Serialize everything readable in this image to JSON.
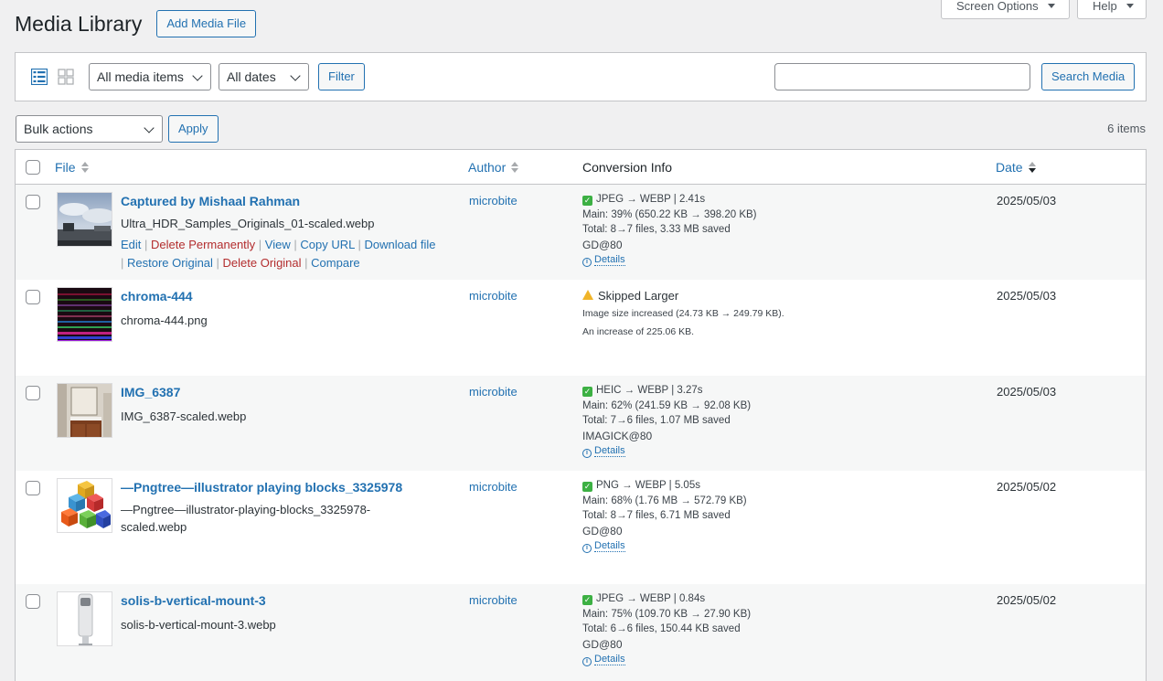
{
  "header": {
    "title": "Media Library",
    "add_new_label": "Add Media File",
    "screen_options_label": "Screen Options",
    "help_label": "Help"
  },
  "filters": {
    "media_type": "All media items",
    "dates": "All dates",
    "filter_label": "Filter",
    "search_placeholder": "",
    "search_button_label": "Search Media"
  },
  "bulk": {
    "action_label": "Bulk actions",
    "apply_label": "Apply",
    "items_count": "6 items"
  },
  "columns": {
    "file": "File",
    "author": "Author",
    "conversion": "Conversion Info",
    "date": "Date"
  },
  "rows": [
    {
      "title": "Captured by Mishaal Rahman",
      "filename": "Ultra_HDR_Samples_Originals_01-scaled.webp",
      "author": "microbite",
      "date": "2025/05/03",
      "actions": {
        "edit": "Edit",
        "delete_permanently": "Delete Permanently",
        "view": "View",
        "copy_url": "Copy URL",
        "download": "Download file",
        "restore": "Restore Original",
        "delete_original": "Delete Original",
        "compare": "Compare"
      },
      "conv": {
        "line1": "JPEG → WEBP | 2.41s",
        "line2": "Main: 39% (650.22 KB → 398.20 KB)",
        "line3": "Total: 8→7 files, 3.33 MB saved",
        "line4": "GD@80",
        "details": "Details"
      }
    },
    {
      "title": "chroma-444",
      "filename": "chroma-444.png",
      "author": "microbite",
      "date": "2025/05/03",
      "conv": {
        "status": "Skipped Larger",
        "line2": "Image size increased (24.73 KB → 249.79 KB).",
        "line3": "An increase of 225.06 KB."
      }
    },
    {
      "title": "IMG_6387",
      "filename": "IMG_6387-scaled.webp",
      "author": "microbite",
      "date": "2025/05/03",
      "conv": {
        "line1": "HEIC → WEBP | 3.27s",
        "line2": "Main: 62% (241.59 KB → 92.08 KB)",
        "line3": "Total: 7→6 files, 1.07 MB saved",
        "line4": "IMAGICK@80",
        "details": "Details"
      }
    },
    {
      "title": "—Pngtree—illustrator playing blocks_3325978",
      "filename": "—Pngtree—illustrator-playing-blocks_3325978-scaled.webp",
      "author": "microbite",
      "date": "2025/05/02",
      "conv": {
        "line1": "PNG → WEBP | 5.05s",
        "line2": "Main: 68% (1.76 MB → 572.79 KB)",
        "line3": "Total: 8→7 files, 6.71 MB saved",
        "line4": "GD@80",
        "details": "Details"
      }
    },
    {
      "title": "solis-b-vertical-mount-3",
      "filename": "solis-b-vertical-mount-3.webp",
      "author": "microbite",
      "date": "2025/05/02",
      "conv": {
        "line1": "JPEG → WEBP | 0.84s",
        "line2": "Main: 75% (109.70 KB → 27.90 KB)",
        "line3": "Total: 6→6 files, 150.44 KB saved",
        "line4": "GD@80",
        "details": "Details"
      }
    }
  ]
}
